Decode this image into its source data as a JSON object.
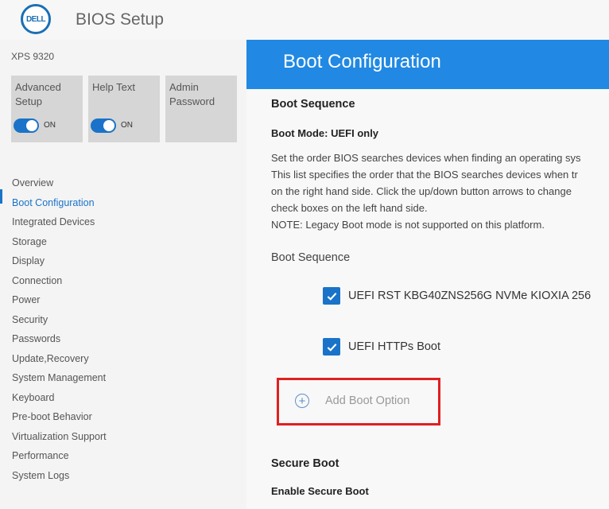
{
  "app": {
    "logo_text": "DELL",
    "title": "BIOS Setup",
    "model": "XPS 9320"
  },
  "tiles": [
    {
      "label": "Advanced Setup",
      "state": "ON",
      "has_toggle": true
    },
    {
      "label": "Help Text",
      "state": "ON",
      "has_toggle": true
    },
    {
      "label": "Admin Password",
      "has_toggle": false
    }
  ],
  "nav": {
    "active": "Boot Configuration",
    "items": [
      "Overview",
      "Boot Configuration",
      "Integrated Devices",
      "Storage",
      "Display",
      "Connection",
      "Power",
      "Security",
      "Passwords",
      "Update,Recovery",
      "System Management",
      "Keyboard",
      "Pre-boot Behavior",
      "Virtualization Support",
      "Performance",
      "System Logs"
    ]
  },
  "main": {
    "title": "Boot Configuration",
    "section_title": "Boot Sequence",
    "boot_mode": "Boot Mode: UEFI only",
    "description": [
      "Set the order BIOS searches devices when finding an operating sys",
      "This list specifies the order that the BIOS searches devices when tr",
      "on the right hand side.  Click the up/down button arrows to change",
      "check boxes on the left hand side.",
      "NOTE: Legacy Boot mode is not supported on this platform."
    ],
    "sequence_title": "Boot Sequence",
    "boot_items": [
      {
        "label": "UEFI RST KBG40ZNS256G NVMe KIOXIA 256",
        "checked": true
      },
      {
        "label": "UEFI HTTPs Boot",
        "checked": true
      }
    ],
    "add_boot_option": "Add Boot Option",
    "secure_boot_title": "Secure Boot",
    "enable_secure_boot": "Enable Secure Boot"
  },
  "colors": {
    "accent": "#1a73c8",
    "header": "#2189e3",
    "highlight": "#e02020"
  }
}
